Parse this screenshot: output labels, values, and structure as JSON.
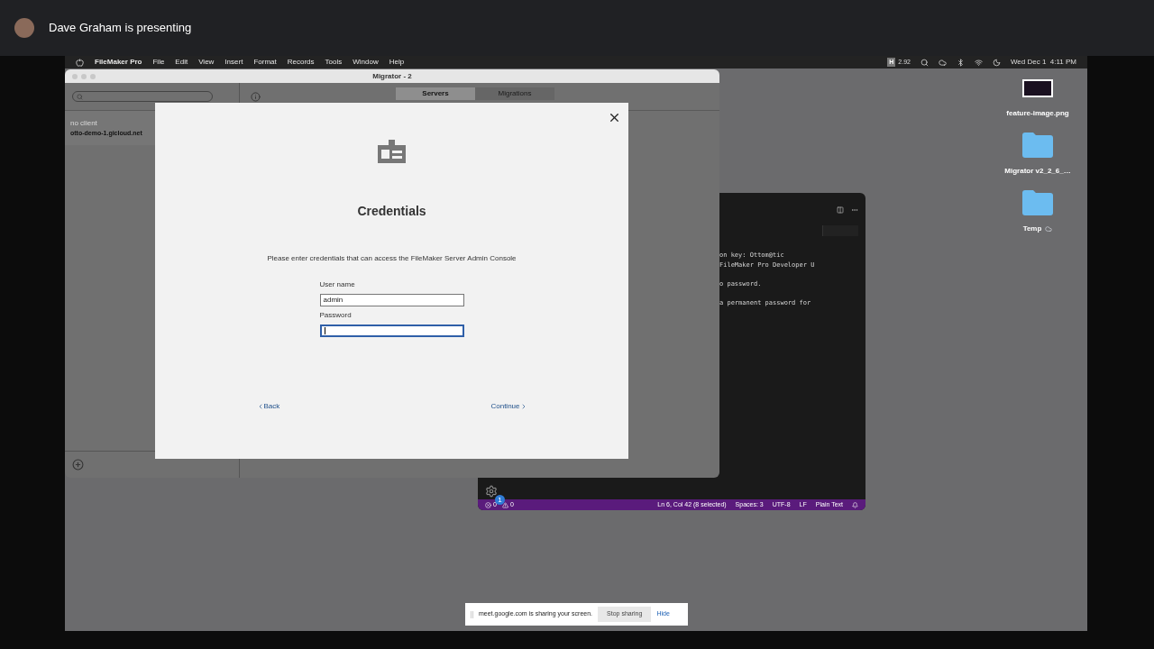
{
  "presenter": {
    "name": "Dave Graham is presenting"
  },
  "menubar": {
    "app": "FileMaker Pro",
    "menus": [
      "File",
      "Edit",
      "View",
      "Insert",
      "Format",
      "Records",
      "Tools",
      "Window",
      "Help"
    ],
    "badge": "H",
    "reading": "2.92",
    "clock": "Wed Dec 1  4:11 PM"
  },
  "filemaker_window": {
    "title": "Migrator - 2",
    "tabs": [
      {
        "label": "Servers",
        "selected": true
      },
      {
        "label": "Migrations",
        "selected": false
      }
    ],
    "sidebar_items": [
      {
        "label": "no client",
        "kind": "caption"
      },
      {
        "label": "otto-demo-1.gicloud.net",
        "kind": "server"
      }
    ]
  },
  "dialog": {
    "title": "Credentials",
    "message": "Please enter credentials that can access the FileMaker Server Admin Console",
    "fields": [
      {
        "label": "User name",
        "value": "admin",
        "focused": false
      },
      {
        "label": "Password",
        "focused": true
      }
    ],
    "back": "Back",
    "continue": "Continue"
  },
  "editor": {
    "paragraphs": [
      [
        "on key: Ottom@tic",
        "FileMaker Pro Developer U"
      ],
      [
        "o password."
      ],
      [
        "a permanent password for"
      ]
    ],
    "settings_badge": "1",
    "errors": "0",
    "warnings": "0",
    "status_items": [
      "Ln 6, Col 42 (8 selected)",
      "Spaces: 3",
      "UTF-8",
      "LF",
      "Plain Text"
    ]
  },
  "desktop_icons": [
    {
      "label": "feature-image.png",
      "kind": "image"
    },
    {
      "label": "Migrator v2_2_6_…",
      "kind": "folder"
    },
    {
      "label": "Temp",
      "kind": "cloud-folder"
    }
  ],
  "share_bar": {
    "message": "meet.google.com is sharing your screen.",
    "stop": "Stop sharing",
    "hide": "Hide"
  }
}
